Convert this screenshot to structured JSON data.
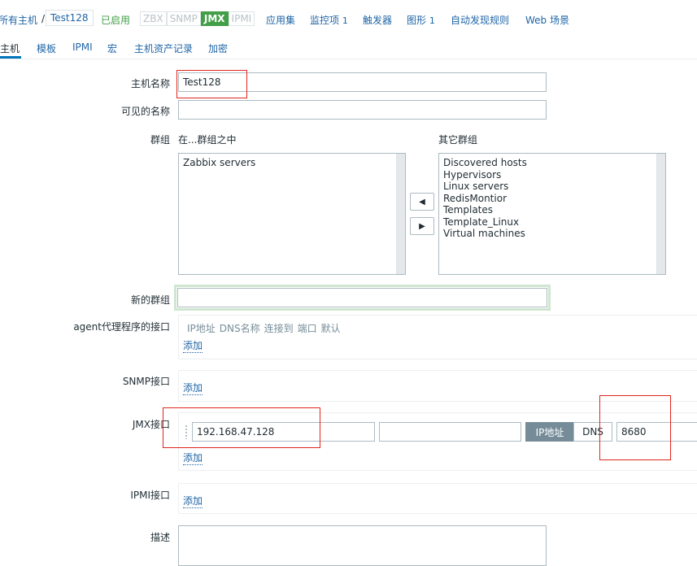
{
  "breadcrumb": {
    "all_hosts": "所有主机",
    "separator": "/",
    "current_host": "Test128",
    "status": "已启用",
    "availability": [
      "ZBX",
      "SNMP",
      "JMX",
      "IPMI"
    ],
    "active_availability": "JMX",
    "links": [
      {
        "label": "应用集",
        "count": ""
      },
      {
        "label": "监控项",
        "count": "1"
      },
      {
        "label": "触发器",
        "count": ""
      },
      {
        "label": "图形",
        "count": "1"
      },
      {
        "label": "自动发现规则",
        "count": ""
      },
      {
        "label": "Web 场景",
        "count": ""
      }
    ]
  },
  "tabs": [
    "主机",
    "模板",
    "IPMI",
    "宏",
    "主机资产记录",
    "加密"
  ],
  "active_tab": "主机",
  "form": {
    "host_name_label": "主机名称",
    "host_name_value": "Test128",
    "visible_name_label": "可见的名称",
    "visible_name_value": "",
    "groups_label": "群组",
    "in_groups_label": "在...群组之中",
    "other_groups_label": "其它群组",
    "in_groups": [
      "Zabbix servers"
    ],
    "other_groups": [
      "Discovered hosts",
      "Hypervisors",
      "Linux servers",
      "RedisMontior",
      "Templates",
      "Template_Linux",
      "Virtual machines"
    ],
    "move_left_icon": "triangle-left",
    "move_right_icon": "triangle-right",
    "new_group_label": "新的群组",
    "new_group_value": "",
    "agent_label": "agent代理程序的接口",
    "agent_columns": [
      "IP地址",
      "DNS名称",
      "连接到",
      "端口",
      "默认"
    ],
    "add_label": "添加",
    "snmp_label": "SNMP接口",
    "jmx_label": "JMX接口",
    "jmx": {
      "ip": "192.168.47.128",
      "dns": "",
      "connect_ip": "IP地址",
      "connect_dns": "DNS",
      "port": "8680"
    },
    "ipmi_label": "IPMI接口",
    "description_label": "描述",
    "description_value": ""
  },
  "colors": {
    "link": "#1f65a6",
    "enabled": "#429e47",
    "highlight": "#e0261c",
    "active_segment": "#768d99",
    "new_group_border": "#cfe6d0"
  }
}
